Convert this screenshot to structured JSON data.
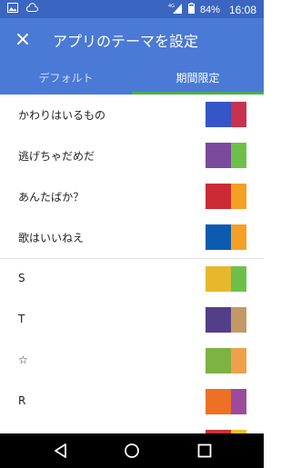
{
  "status_bar": {
    "battery": "84%",
    "time": "16:08",
    "network": "4G"
  },
  "app_bar": {
    "title": "アプリのテーマを設定",
    "close_icon": "close-icon"
  },
  "tabs": [
    {
      "label": "デフォルト",
      "active": false
    },
    {
      "label": "期間限定",
      "active": true
    }
  ],
  "themes": [
    {
      "label": "かわりはいるもの",
      "colors": [
        "#3556c8",
        "#c83250"
      ]
    },
    {
      "label": "逃げちゃだめだ",
      "colors": [
        "#7c4a9c",
        "#6cc04a"
      ]
    },
    {
      "label": "あんたばか？",
      "colors": [
        "#cc2a34",
        "#f4a024"
      ]
    },
    {
      "label": "歌はいいねえ",
      "colors": [
        "#0d5bb0",
        "#f4a024"
      ]
    },
    {
      "label": "S",
      "colors": [
        "#e8b82c",
        "#6cc04a"
      ]
    },
    {
      "label": "T",
      "colors": [
        "#533e8a",
        "#c49766"
      ]
    },
    {
      "label": "☆",
      "colors": [
        "#7cb342",
        "#f0a04a"
      ]
    },
    {
      "label": "R",
      "colors": [
        "#ee7024",
        "#9c4a9c"
      ]
    }
  ],
  "partial_row_colors": [
    "#cc3434",
    "#f4c024"
  ],
  "colors": {
    "status_bar": "#3a66c2",
    "app_bar": "#4a7ad5",
    "tab_indicator": "#4caf50"
  }
}
